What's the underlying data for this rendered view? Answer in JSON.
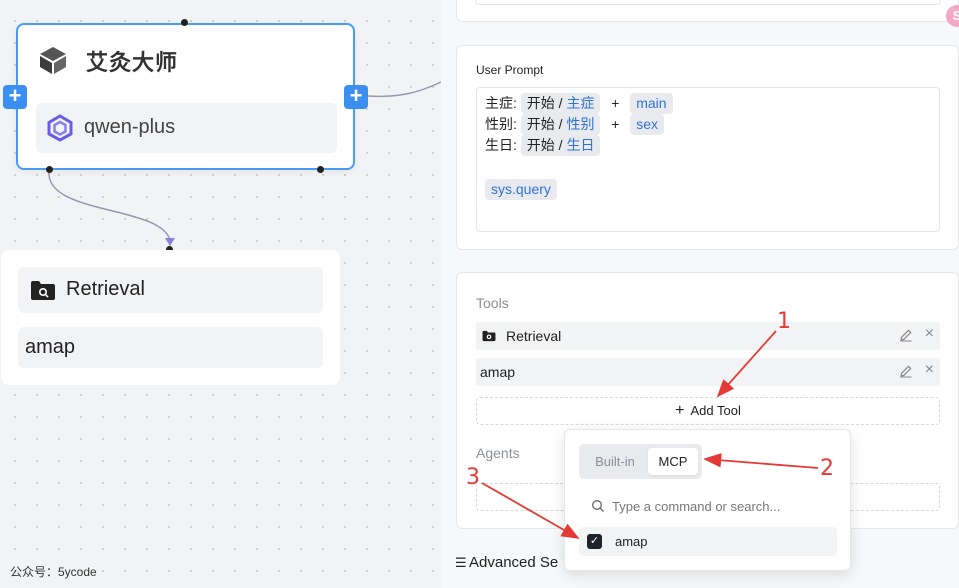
{
  "canvas": {
    "agent_node": {
      "title": "艾灸大师",
      "model": "qwen-plus",
      "plus_symbol": "+"
    },
    "retrieval_node": {
      "items": [
        "Retrieval",
        "amap"
      ]
    },
    "watermark": "公众号：5ycode"
  },
  "panel": {
    "badge": "S",
    "user_prompt": {
      "label": "User Prompt",
      "lines": [
        {
          "label": "主症:",
          "tag_prefix": "开始 / ",
          "tag_var": "主症",
          "plus": "+",
          "var": "main"
        },
        {
          "label": "性别:",
          "tag_prefix": "开始 / ",
          "tag_var": "性别",
          "plus": "+",
          "var": "sex"
        },
        {
          "label": "生日:",
          "tag_prefix": "开始 / ",
          "tag_var": "生日"
        }
      ],
      "sys_var": "sys.query"
    },
    "tools": {
      "label": "Tools",
      "items": [
        "Retrieval",
        "amap"
      ],
      "add_label": "Add Tool",
      "add_symbol": "+",
      "close_symbol": "×"
    },
    "agents": {
      "label": "Agents"
    },
    "advanced_label": "Advanced Se"
  },
  "dropdown": {
    "tabs": [
      "Built-in",
      "MCP"
    ],
    "active_tab": "MCP",
    "search_placeholder": "Type a command or search...",
    "options": [
      {
        "label": "amap",
        "checked": true
      }
    ],
    "check_symbol": "✓"
  },
  "annotations": {
    "labels": [
      "1",
      "2",
      "3"
    ],
    "color": "#e53935"
  },
  "colors": {
    "accent": "#3b8ff0",
    "variable_blue": "#2f73d9"
  }
}
